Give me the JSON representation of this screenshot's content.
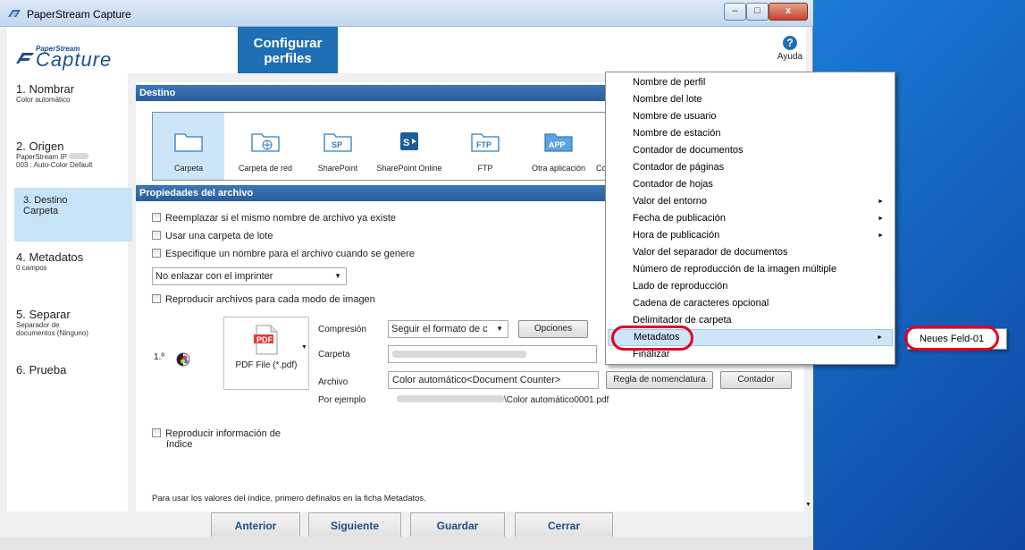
{
  "window": {
    "title": "PaperStream Capture",
    "controls": {
      "minimize": "–",
      "maximize": "□",
      "close": "x"
    }
  },
  "header": {
    "logo_small": "PaperStream",
    "logo_big": "Capture",
    "config_tab_line1": "Configurar",
    "config_tab_line2": "perfiles",
    "help_icon": "?",
    "help_label": "Ayuda"
  },
  "steps": [
    {
      "title": "1. Nombrar",
      "sub": "Color automático"
    },
    {
      "title": "2. Origen",
      "sub": "PaperStream IP",
      "sub2": "003 : Auto-Color Default"
    },
    {
      "title": "3. Destino",
      "sub": "Carpeta"
    },
    {
      "title": "4. Metadatos",
      "sub": "0 campos"
    },
    {
      "title": "5. Separar",
      "sub": "Separador de",
      "sub2": "documentos (Ninguno)"
    },
    {
      "title": "6. Prueba"
    }
  ],
  "destino": {
    "section_title": "Destino",
    "items": [
      {
        "label": "Carpeta",
        "icon": "folder-icon"
      },
      {
        "label": "Carpeta de red",
        "icon": "network-folder-icon"
      },
      {
        "label": "SharePoint",
        "icon": "sharepoint-icon",
        "glyph": "SP"
      },
      {
        "label": "SharePoint Online",
        "icon": "sharepoint-online-icon",
        "glyph": "S▸"
      },
      {
        "label": "FTP",
        "icon": "ftp-icon",
        "glyph": "FTP"
      },
      {
        "label": "Otra aplicación",
        "icon": "app-icon",
        "glyph": "APP"
      },
      {
        "label": "Correo",
        "icon": "mail-icon"
      }
    ]
  },
  "props": {
    "section_title": "Propiedades del archivo",
    "chk_replace": "Reemplazar si el mismo nombre de archivo ya existe",
    "chk_batch_folder": "Usar una carpeta de lote",
    "chk_specify_name": "Especifique un nombre para el archivo cuando se genere",
    "imprinter_select": "No enlazar con el imprinter",
    "chk_per_mode": "Reproducir archivos para cada modo de imagen",
    "row_number": "1.º",
    "file_type": "PDF File (*.pdf)",
    "pdf_badge": "PDF",
    "compression_label": "Compresión",
    "compression_value": "Seguir el formato de c",
    "options_button": "Opciones",
    "folder_label": "Carpeta",
    "file_label": "Archivo",
    "file_value": "Color automático<Document Counter>",
    "naming_rule_button": "Regla de nomenclatura",
    "counter_button": "Contador",
    "example_label": "Por ejemplo",
    "example_value": "\\Color automático0001.pdf",
    "chk_index_line1": "Reproducir información de",
    "chk_index_line2": "índice",
    "note": "Para usar los valores del índice, primero defínalos en la ficha Metadatos."
  },
  "nav_buttons": {
    "prev": "Anterior",
    "next": "Siguiente",
    "save": "Guardar",
    "close": "Cerrar"
  },
  "context_menu": {
    "items": [
      {
        "label": "Nombre de perfil"
      },
      {
        "label": "Nombre del lote"
      },
      {
        "label": "Nombre de usuario"
      },
      {
        "label": "Nombre de estación"
      },
      {
        "label": "Contador de documentos"
      },
      {
        "label": "Contador de páginas"
      },
      {
        "label": "Contador de hojas"
      },
      {
        "label": "Valor del entorno",
        "submenu": true
      },
      {
        "label": "Fecha de publicación",
        "submenu": true
      },
      {
        "label": "Hora de publicación",
        "submenu": true
      },
      {
        "label": "Valor del separador de documentos"
      },
      {
        "label": "Número de reproducción de la imagen múltiple"
      },
      {
        "label": "Lado de reproducción"
      },
      {
        "label": "Cadena de caracteres opcional"
      },
      {
        "label": "Delimitador de carpeta"
      },
      {
        "label": "Metadatos",
        "submenu": true,
        "highlighted": true
      },
      {
        "label": "Finalizar"
      }
    ],
    "submenu_arrow": "►",
    "submenu_item": "Neues Feld-01"
  },
  "colors": {
    "accent": "#1f6fb5",
    "section_bar": "#2a5e9b",
    "selected_step": "#c6e3f7",
    "highlight_oval": "#e6001f",
    "desktop": "#1e88e5"
  }
}
